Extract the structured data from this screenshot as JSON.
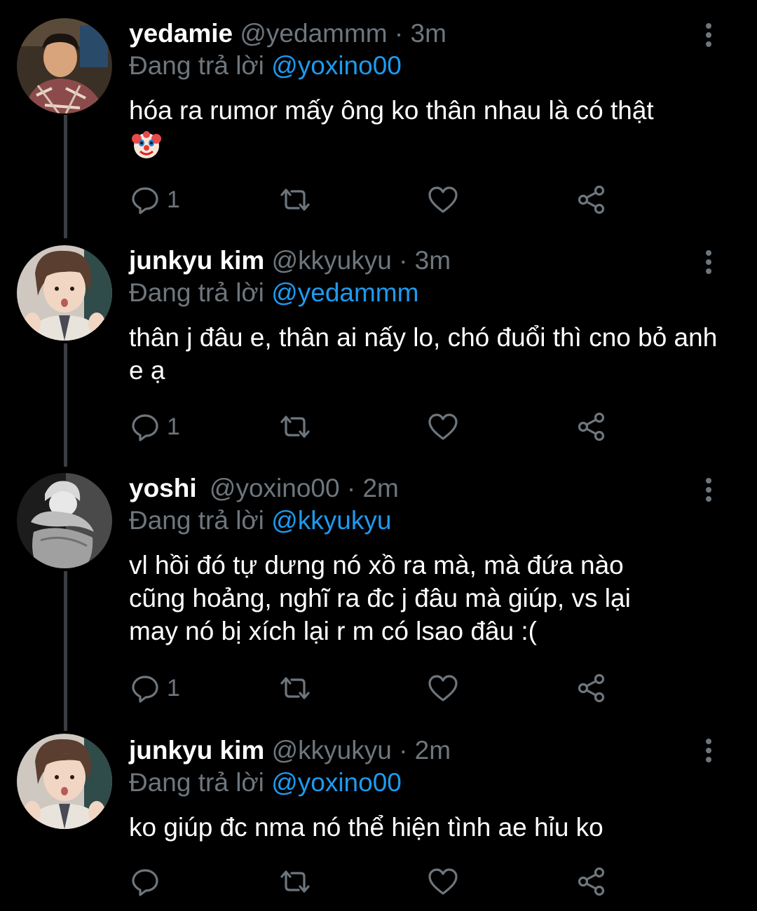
{
  "colors": {
    "background": "#000000",
    "text": "#ffffff",
    "muted": "#6e767d",
    "mention": "#1d9bf0",
    "thread_line": "#3a3e42"
  },
  "icons": {
    "reply": "reply-icon",
    "retweet": "retweet-icon",
    "like": "heart-icon",
    "share": "share-icon",
    "more": "more-options-icon"
  },
  "tweets": [
    {
      "name": "yedamie",
      "handle": "@yedammm",
      "sep": "·",
      "time": "3m",
      "reply_prefix": "Đang trả lời",
      "reply_to": "@yoxino00",
      "text": "hóa ra rumor mấy ông ko thân nhau là có thật",
      "emoji": "clown-face-emoji",
      "reply_count": "1"
    },
    {
      "name": "junkyu kim",
      "handle": "@kkyukyu",
      "sep": "·",
      "time": "3m",
      "reply_prefix": "Đang trả lời",
      "reply_to": "@yedammm",
      "text": "thân j đâu e, thân ai nấy lo, chó đuổi thì cno bỏ anh e ạ",
      "reply_count": "1"
    },
    {
      "name": "yoshi",
      "handle": "@yoxino00",
      "sep": "·",
      "time": "2m",
      "reply_prefix": "Đang trả lời",
      "reply_to": "@kkyukyu",
      "text": "vl hồi đó tự dưng nó xồ ra mà, mà đứa nào cũng hoảng, nghĩ ra đc j đâu mà giúp, vs lại may nó bị xích lại r m có lsao đâu :(",
      "reply_count": "1"
    },
    {
      "name": "junkyu kim",
      "handle": "@kkyukyu",
      "sep": "·",
      "time": "2m",
      "reply_prefix": "Đang trả lời",
      "reply_to": "@yoxino00",
      "text": "ko giúp đc nma nó thể hiện tình ae hỉu ko",
      "reply_count": ""
    }
  ]
}
